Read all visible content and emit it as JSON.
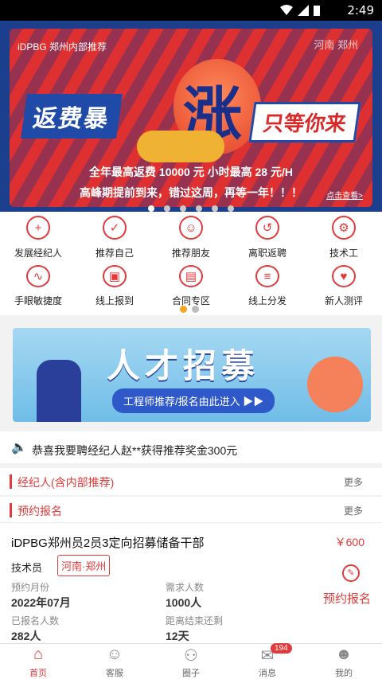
{
  "status_bar": {
    "time": "2:49",
    "icons": [
      "wifi-icon",
      "signal-icon",
      "battery-icon"
    ]
  },
  "banner": {
    "top_left": "iDPBG 郑州内部推荐",
    "top_right": "河南 郑州",
    "slogan_left": "返费暴",
    "slogan_big": "涨",
    "slogan_right": "只等你来",
    "line1": "全年最高返费 10000 元  小时最高 28 元/H",
    "line2": "高峰期提前到来，错过这周，再等一年！！！",
    "more": "点击查看>",
    "dots": 6,
    "active_dot": 0
  },
  "menu": {
    "items": [
      {
        "label": "发展经纪人",
        "icon": "user-add-icon"
      },
      {
        "label": "推荐自己",
        "icon": "recommend-icon"
      },
      {
        "label": "推荐朋友",
        "icon": "friends-icon"
      },
      {
        "label": "离职返聘",
        "icon": "rehire-icon"
      },
      {
        "label": "技术工",
        "icon": "worker-icon"
      },
      {
        "label": "手眼敏捷度",
        "icon": "dexterity-icon"
      },
      {
        "label": "线上报到",
        "icon": "checkin-icon"
      },
      {
        "label": "合同专区",
        "icon": "contract-icon"
      },
      {
        "label": "线上分发",
        "icon": "distribute-icon"
      },
      {
        "label": "新人测评",
        "icon": "heartbeat-icon"
      }
    ]
  },
  "recruit": {
    "title": "人才招募",
    "pill": "工程师推荐/报名由此进入 ▶▶"
  },
  "notice": {
    "text": "恭喜我要聘经纪人赵**获得推荐奖金300元"
  },
  "sections": {
    "agent": {
      "title": "经纪人(含内部推荐)",
      "more": "更多"
    },
    "booking": {
      "title": "预约报名",
      "more": "更多"
    }
  },
  "job": {
    "title": "iDPBG郑州员2员3定向招募储备干部",
    "price": "￥600",
    "role": "技术员",
    "location": "河南·郑州",
    "fields": [
      {
        "key": "预约月份",
        "value": "2022年07月"
      },
      {
        "key": "需求人数",
        "value": "1000人"
      },
      {
        "key": "已报名人数",
        "value": "282人"
      },
      {
        "key": "距离结束还剩",
        "value": "12天"
      }
    ],
    "book_label": "预约报名"
  },
  "tabbar": {
    "tabs": [
      {
        "label": "首页",
        "icon": "home-icon"
      },
      {
        "label": "客服",
        "icon": "customer-service-icon"
      },
      {
        "label": "圈子",
        "icon": "circle-icon"
      },
      {
        "label": "消息",
        "icon": "message-icon",
        "badge": "194"
      },
      {
        "label": "我的",
        "icon": "profile-icon"
      }
    ],
    "active": 0
  },
  "colors": {
    "accent": "#e23a3a",
    "banner_blue": "#1b3f8c"
  }
}
